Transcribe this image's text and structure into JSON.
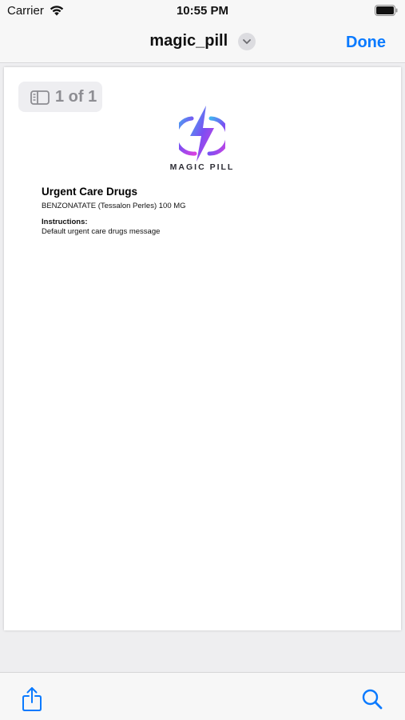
{
  "status_bar": {
    "carrier": "Carrier",
    "time": "10:55 PM",
    "wifi_icon": "wifi-icon",
    "battery_icon": "battery-full-icon"
  },
  "nav": {
    "title": "magic_pill",
    "title_menu_icon": "chevron-down-circle-icon",
    "done_label": "Done",
    "accent_color": "#0a7aff"
  },
  "page_counter": {
    "icon": "sidebar-icon",
    "label": "1 of 1"
  },
  "document": {
    "logo_text": "MAGIC PILL",
    "heading": "Urgent Care Drugs",
    "drug_line": "BENZONATATE (Tessalon Perles) 100 MG",
    "instructions_label": "Instructions:",
    "instructions_text": "Default urgent care drugs message",
    "logo_gradient": [
      "#3fb8f0",
      "#7b4ff2",
      "#d93fe0"
    ]
  },
  "toolbar": {
    "share_icon": "share-icon",
    "search_icon": "search-icon"
  }
}
